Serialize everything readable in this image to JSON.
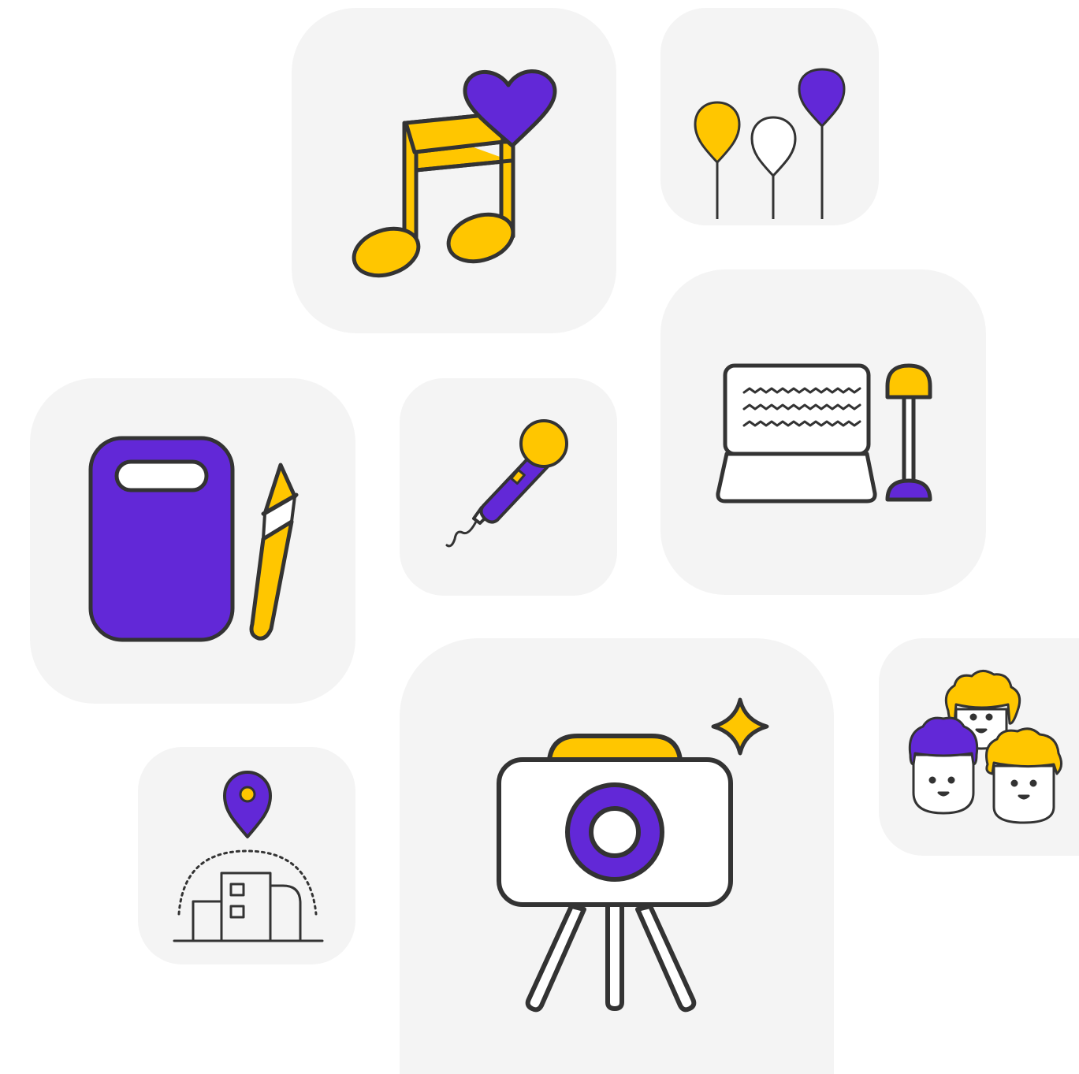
{
  "colors": {
    "tile_background": "#f4f4f4",
    "accent_yellow": "#ffc600",
    "accent_purple": "#6228d7",
    "outline": "#333333",
    "fill_white": "#ffffff"
  },
  "tiles": [
    {
      "id": "music",
      "icon": "music-note-heart-icon"
    },
    {
      "id": "balloons",
      "icon": "balloons-icon"
    },
    {
      "id": "laptop",
      "icon": "laptop-with-desk-lamp-icon"
    },
    {
      "id": "mic",
      "icon": "microphone-icon"
    },
    {
      "id": "art",
      "icon": "palette-and-brush-icon"
    },
    {
      "id": "people",
      "icon": "group-of-people-icon"
    },
    {
      "id": "location",
      "icon": "location-pin-building-icon"
    },
    {
      "id": "camera",
      "icon": "camera-on-tripod-icon"
    }
  ]
}
